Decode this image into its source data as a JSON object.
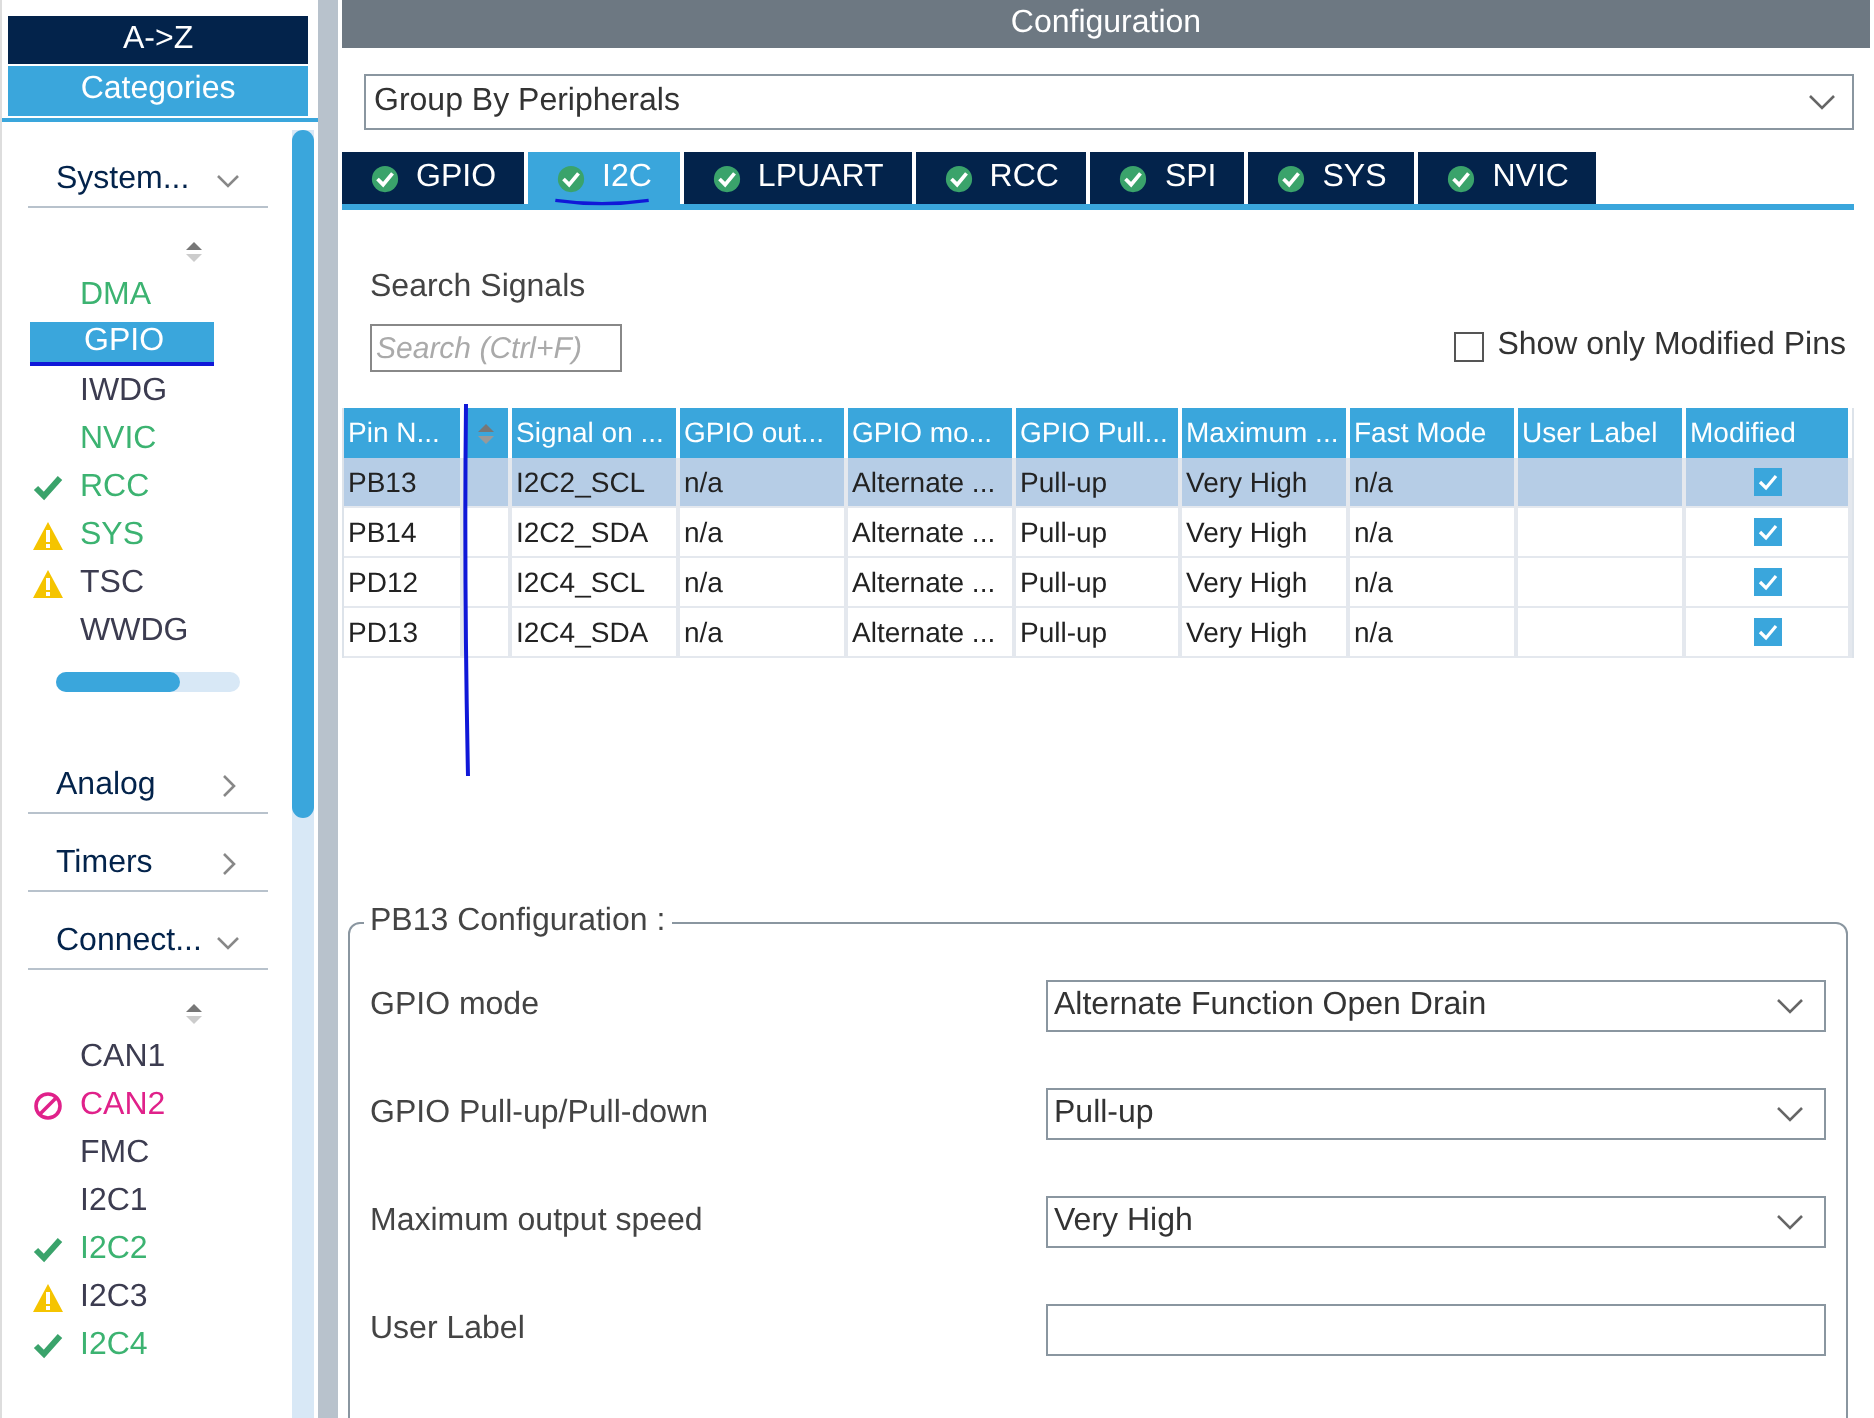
{
  "sidebar": {
    "sort_tabs": [
      {
        "label": "A->Z",
        "selected": false
      },
      {
        "label": "Categories",
        "selected": true
      }
    ],
    "groups": [
      {
        "title": "System...",
        "expanded": true,
        "items": [
          {
            "label": "DMA",
            "kind": "none",
            "configured": true,
            "selected": false
          },
          {
            "label": "GPIO",
            "kind": "none",
            "configured": true,
            "selected": true
          },
          {
            "label": "IWDG",
            "kind": "none",
            "configured": false,
            "selected": false
          },
          {
            "label": "NVIC",
            "kind": "none",
            "configured": true,
            "selected": false
          },
          {
            "label": "RCC",
            "kind": "check",
            "configured": true,
            "selected": false
          },
          {
            "label": "SYS",
            "kind": "warning",
            "configured": true,
            "selected": false
          },
          {
            "label": "TSC",
            "kind": "warning",
            "configured": false,
            "selected": false
          },
          {
            "label": "WWDG",
            "kind": "none",
            "configured": false,
            "selected": false
          }
        ]
      },
      {
        "title": "Analog",
        "expanded": false
      },
      {
        "title": "Timers",
        "expanded": false
      },
      {
        "title": "Connect...",
        "expanded": true,
        "items": [
          {
            "label": "CAN1",
            "kind": "none",
            "configured": false,
            "selected": false
          },
          {
            "label": "CAN2",
            "kind": "blocked",
            "selected": false
          },
          {
            "label": "FMC",
            "kind": "none",
            "configured": false,
            "selected": false
          },
          {
            "label": "I2C1",
            "kind": "none",
            "configured": false,
            "selected": false
          },
          {
            "label": "I2C2",
            "kind": "check",
            "configured": true,
            "selected": false
          },
          {
            "label": "I2C3",
            "kind": "warning",
            "configured": false,
            "selected": false
          },
          {
            "label": "I2C4",
            "kind": "check",
            "configured": true,
            "selected": false
          }
        ]
      }
    ]
  },
  "configuration": {
    "title": "Configuration",
    "group_by": "Group By Peripherals",
    "tabs": [
      {
        "label": "GPIO",
        "selected": false
      },
      {
        "label": "I2C",
        "selected": true
      },
      {
        "label": "LPUART",
        "selected": false
      },
      {
        "label": "RCC",
        "selected": false
      },
      {
        "label": "SPI",
        "selected": false
      },
      {
        "label": "SYS",
        "selected": false
      },
      {
        "label": "NVIC",
        "selected": false
      }
    ],
    "search_label": "Search Signals",
    "search": {
      "placeholder": "Search (Ctrl+F)"
    },
    "show_modified": {
      "label": "Show only Modified Pins",
      "checked": false
    },
    "table": {
      "columns": [
        "Pin N...",
        "Signal on ...",
        "GPIO out...",
        "GPIO mo...",
        "GPIO Pull...",
        "Maximum ...",
        "Fast Mode",
        "User Label",
        "Modified"
      ],
      "rows": [
        {
          "cells": [
            "PB13",
            "I2C2_SCL",
            "n/a",
            "Alternate ...",
            "Pull-up",
            "Very High",
            "n/a",
            ""
          ],
          "modified": true,
          "selected": true
        },
        {
          "cells": [
            "PB14",
            "I2C2_SDA",
            "n/a",
            "Alternate ...",
            "Pull-up",
            "Very High",
            "n/a",
            ""
          ],
          "modified": true,
          "selected": false
        },
        {
          "cells": [
            "PD12",
            "I2C4_SCL",
            "n/a",
            "Alternate ...",
            "Pull-up",
            "Very High",
            "n/a",
            ""
          ],
          "modified": true,
          "selected": false
        },
        {
          "cells": [
            "PD13",
            "I2C4_SDA",
            "n/a",
            "Alternate ...",
            "Pull-up",
            "Very High",
            "n/a",
            ""
          ],
          "modified": true,
          "selected": false
        }
      ]
    },
    "pin_config": {
      "title": "PB13 Configuration :",
      "fields": [
        {
          "label": "GPIO mode",
          "kind": "select",
          "value": "Alternate Function Open Drain"
        },
        {
          "label": "GPIO Pull-up/Pull-down",
          "kind": "select",
          "value": "Pull-up"
        },
        {
          "label": "Maximum output speed",
          "kind": "select",
          "value": "Very High"
        },
        {
          "label": "User Label",
          "kind": "text"
        }
      ]
    }
  }
}
